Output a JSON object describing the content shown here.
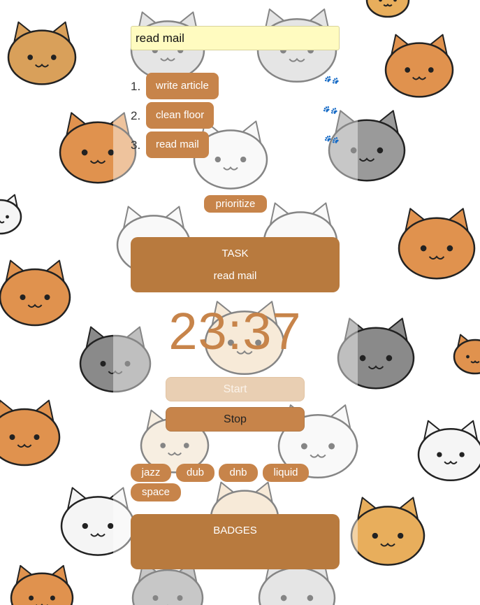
{
  "task_input": {
    "value": "read mail"
  },
  "todos": [
    {
      "number": "1.",
      "label": "write article"
    },
    {
      "number": "2.",
      "label": "clean floor"
    },
    {
      "number": "3.",
      "label": "read mail"
    }
  ],
  "prioritize_label": "prioritize",
  "task_panel": {
    "title": "TASK",
    "current": "read mail"
  },
  "timer": "23:37",
  "controls": {
    "start_label": "Start",
    "stop_label": "Stop"
  },
  "genres": [
    "jazz",
    "dub",
    "dnb",
    "liquid",
    "space"
  ],
  "badges_panel": {
    "title": "BADGES"
  },
  "colors": {
    "accent": "#c7844a",
    "panel": "#b87a3e",
    "input_bg": "#fffbc0",
    "start_disabled": "#e9cfb3"
  },
  "icons": [
    "paw-print-icon",
    "cat-face-icon"
  ]
}
